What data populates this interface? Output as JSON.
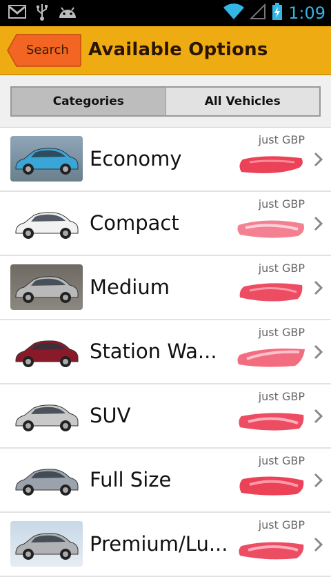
{
  "status_bar": {
    "icons": [
      "gmail-icon",
      "usb-icon",
      "android-debug-icon",
      "wifi-icon",
      "signal-icon",
      "battery-charging-icon"
    ],
    "time": "1:09"
  },
  "header": {
    "back_label": "Search",
    "title": "Available Options"
  },
  "tabs": [
    {
      "label": "Categories",
      "active": true
    },
    {
      "label": "All Vehicles",
      "active": false
    }
  ],
  "price_caption": "just GBP",
  "vehicles": [
    {
      "label": "Economy",
      "car_color": "#3aa6d8"
    },
    {
      "label": "Compact",
      "car_color": "#f2f2f2"
    },
    {
      "label": "Medium",
      "car_color": "#b9b9b9"
    },
    {
      "label": "Station Wa...",
      "car_color": "#8a1a2a"
    },
    {
      "label": "SUV",
      "car_color": "#c9c9c9"
    },
    {
      "label": "Full Size",
      "car_color": "#9aa3ab"
    },
    {
      "label": "Premium/Lu...",
      "car_color": "#b0b2b5"
    }
  ],
  "colors": {
    "action_bar": "#efac12",
    "back_button": "#f26522",
    "status_accent": "#33b5e5",
    "price_redaction": "#e8213b"
  }
}
